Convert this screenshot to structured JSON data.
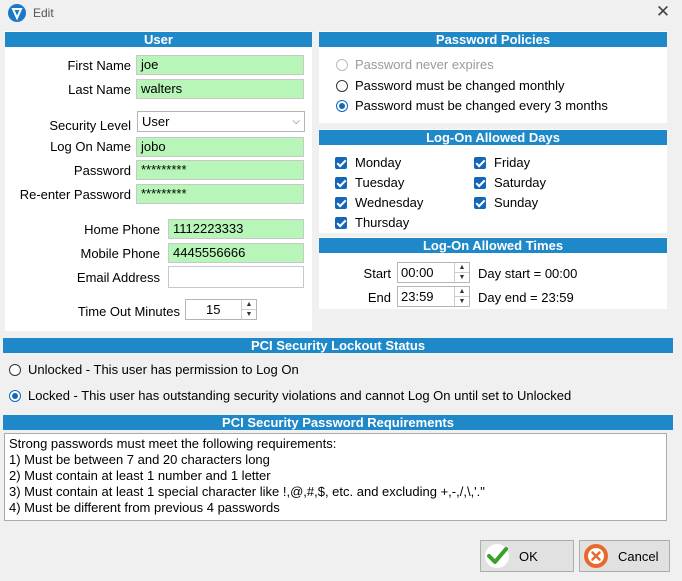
{
  "window": {
    "title": "Edit",
    "close_glyph": "✕"
  },
  "user": {
    "header": "User",
    "first_name_label": "First Name",
    "first_name": "joe",
    "last_name_label": "Last Name",
    "last_name": "walters",
    "security_level_label": "Security Level",
    "security_level": "User",
    "log_on_name_label": "Log On Name",
    "log_on_name": "jobo",
    "password_label": "Password",
    "password": "*********",
    "reenter_password_label": "Re-enter Password",
    "reenter_password": "*********",
    "home_phone_label": "Home Phone",
    "home_phone": "1112223333",
    "mobile_phone_label": "Mobile Phone",
    "mobile_phone": "4445556666",
    "email_label": "Email Address",
    "email": "",
    "timeout_label": "Time Out Minutes",
    "timeout": "15"
  },
  "password_policies": {
    "header": "Password Policies",
    "options": [
      {
        "label": "Password never expires",
        "selected": false,
        "enabled": false
      },
      {
        "label": "Password must be changed monthly",
        "selected": false,
        "enabled": true
      },
      {
        "label": "Password must be changed every 3 months",
        "selected": true,
        "enabled": true
      }
    ]
  },
  "allowed_days": {
    "header": "Log-On Allowed Days",
    "days": [
      {
        "label": "Monday",
        "checked": true
      },
      {
        "label": "Tuesday",
        "checked": true
      },
      {
        "label": "Wednesday",
        "checked": true
      },
      {
        "label": "Thursday",
        "checked": true
      },
      {
        "label": "Friday",
        "checked": true
      },
      {
        "label": "Saturday",
        "checked": true
      },
      {
        "label": "Sunday",
        "checked": true
      }
    ]
  },
  "allowed_times": {
    "header": "Log-On Allowed Times",
    "start_label": "Start",
    "start": "00:00",
    "start_note": "Day start = 00:00",
    "end_label": "End",
    "end": "23:59",
    "end_note": "Day end = 23:59"
  },
  "lockout": {
    "header": "PCI Security Lockout Status",
    "unlocked_label": "Unlocked - This user has permission to Log On",
    "locked_label": "Locked - This user has outstanding security violations and cannot Log On until set to Unlocked",
    "selected": "locked"
  },
  "requirements": {
    "header": "PCI Security Password Requirements",
    "lines": [
      "Strong passwords must meet the following requirements:",
      "1) Must be between 7 and 20 characters long",
      "2) Must contain at least 1 number and 1 letter",
      "3) Must contain at least 1 special character like !,@,#,$, etc. and excluding +,-,/,\\,'.\"",
      "4) Must be different from previous 4 passwords"
    ]
  },
  "buttons": {
    "ok": "OK",
    "cancel": "Cancel"
  },
  "colors": {
    "header_blue": "#1e88c8",
    "field_green": "#b8f5b8",
    "accent": "#1466b8"
  }
}
